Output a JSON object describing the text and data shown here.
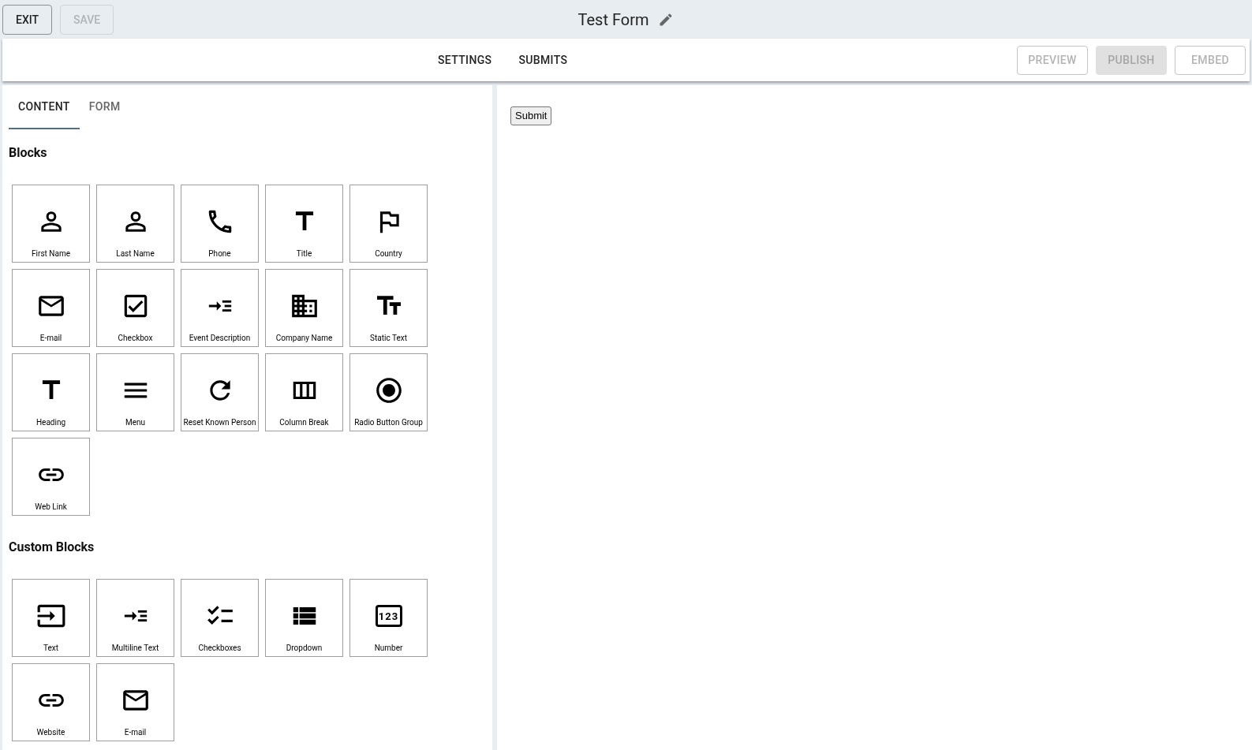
{
  "header": {
    "buttons": [
      {
        "label": "EXIT",
        "disabled": false
      },
      {
        "label": "SAVE",
        "disabled": true
      }
    ],
    "title": "Test Form"
  },
  "toolbar": {
    "links": [
      "SETTINGS",
      "SUBMITS"
    ],
    "buttons": [
      {
        "label": "PREVIEW",
        "kind": "outlined",
        "disabled": true
      },
      {
        "label": "PUBLISH",
        "kind": "filled",
        "disabled": true
      },
      {
        "label": "EMBED",
        "kind": "outlined",
        "disabled": true
      }
    ]
  },
  "tabs": [
    {
      "label": "CONTENT",
      "selected": true
    },
    {
      "label": "FORM",
      "selected": false
    }
  ],
  "sections": [
    {
      "heading": "Blocks",
      "blocks": [
        {
          "label": "First Name",
          "kind": "name"
        },
        {
          "label": "Last Name",
          "kind": "name"
        },
        {
          "label": "Phone",
          "kind": "phone"
        },
        {
          "label": "Title",
          "kind": "title"
        },
        {
          "label": "Country",
          "kind": "country"
        },
        {
          "label": "E-mail",
          "kind": "email"
        },
        {
          "label": "Checkbox",
          "kind": "checkbox"
        },
        {
          "label": "Event Description",
          "kind": "multiline"
        },
        {
          "label": "Company Name",
          "kind": "company"
        },
        {
          "label": "Static Text",
          "kind": "static_text"
        },
        {
          "label": "Heading",
          "kind": "title"
        },
        {
          "label": "Menu",
          "kind": "menu"
        },
        {
          "label": "Reset Known Person",
          "kind": "reset"
        },
        {
          "label": "Column Break",
          "kind": "column_break"
        },
        {
          "label": "Radio Button Group",
          "kind": "radio"
        },
        {
          "label": "Web Link",
          "kind": "link"
        }
      ]
    },
    {
      "heading": "Custom Blocks",
      "blocks": [
        {
          "label": "Text",
          "kind": "text"
        },
        {
          "label": "Multiline Text",
          "kind": "multiline"
        },
        {
          "label": "Checkboxes",
          "kind": "checkboxes"
        },
        {
          "label": "Dropdown",
          "kind": "dropdown"
        },
        {
          "label": "Number",
          "kind": "number",
          "icon_text": "123"
        },
        {
          "label": "Website",
          "kind": "link"
        },
        {
          "label": "E-mail",
          "kind": "email"
        }
      ]
    }
  ],
  "preview": {
    "submit_button": "Submit"
  }
}
